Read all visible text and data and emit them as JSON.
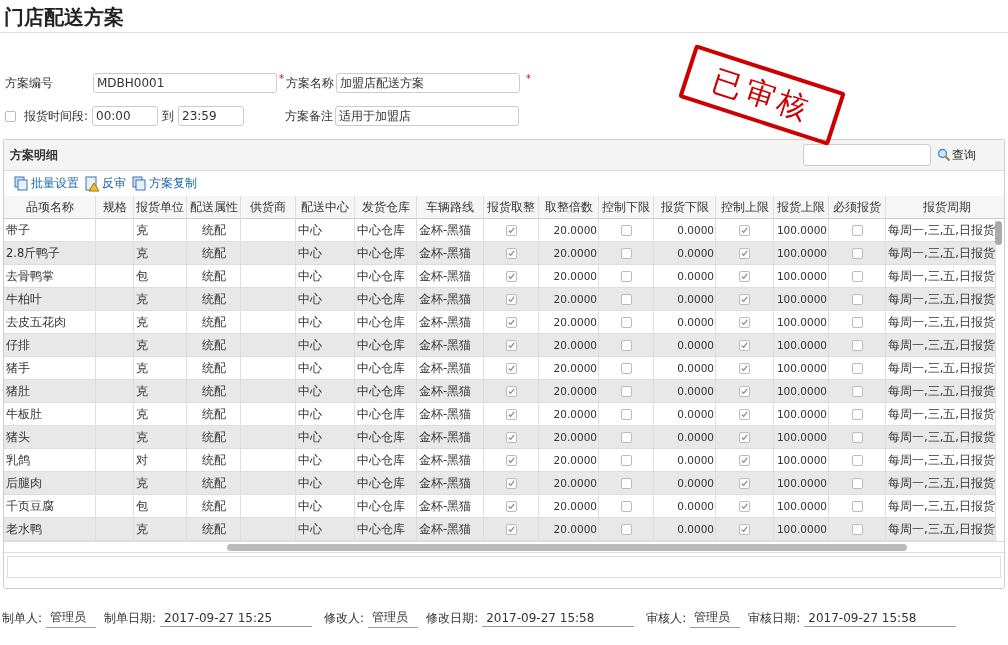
{
  "page_title": "门店配送方案",
  "stamp": "已审核",
  "form": {
    "code": {
      "label": "方案编号",
      "value": "MDBH0001"
    },
    "name": {
      "required_mark": "*",
      "label": "方案名称",
      "value": "加盟店配送方案",
      "trailing_mark": "*"
    },
    "time_range": {
      "checked": false,
      "label": "报货时间段",
      "separator": ":",
      "from": "00:00",
      "to_label": "到",
      "to": "23:59"
    },
    "note": {
      "label": "方案备注",
      "value": "适用于加盟店"
    }
  },
  "panel": {
    "title": "方案明细",
    "search": {
      "button": "查询"
    },
    "toolbar": [
      {
        "label": "批量设置"
      },
      {
        "label": "反审"
      },
      {
        "label": "方案复制"
      }
    ],
    "table": {
      "columns": [
        {
          "label": "品项名称",
          "kind": "text"
        },
        {
          "label": "规格",
          "kind": "text"
        },
        {
          "label": "报货单位",
          "kind": "text"
        },
        {
          "label": "配送属性",
          "kind": "center"
        },
        {
          "label": "供货商",
          "kind": "text"
        },
        {
          "label": "配送中心",
          "kind": "text"
        },
        {
          "label": "发货仓库",
          "kind": "text"
        },
        {
          "label": "车辆路线",
          "kind": "text"
        },
        {
          "label": "报货取整",
          "kind": "check"
        },
        {
          "label": "取整倍数",
          "kind": "number"
        },
        {
          "label": "控制下限",
          "kind": "check"
        },
        {
          "label": "报货下限",
          "kind": "number"
        },
        {
          "label": "控制上限",
          "kind": "check"
        },
        {
          "label": "报货上限",
          "kind": "number"
        },
        {
          "label": "必须报货",
          "kind": "check"
        },
        {
          "label": "报货周期",
          "kind": "text"
        }
      ],
      "rows": [
        {
          "cells": [
            "带子",
            "",
            "克",
            "统配",
            "",
            "中心",
            "中心仓库",
            "金杯-黑猫",
            true,
            "20.0000",
            false,
            "0.0000",
            true,
            "100.0000",
            false,
            "每周一,三,五,日报货"
          ]
        },
        {
          "cells": [
            "2.8斤鸭子",
            "",
            "克",
            "统配",
            "",
            "中心",
            "中心仓库",
            "金杯-黑猫",
            true,
            "20.0000",
            false,
            "0.0000",
            true,
            "100.0000",
            false,
            "每周一,三,五,日报货"
          ]
        },
        {
          "cells": [
            "去骨鸭掌",
            "",
            "包",
            "统配",
            "",
            "中心",
            "中心仓库",
            "金杯-黑猫",
            true,
            "20.0000",
            false,
            "0.0000",
            true,
            "100.0000",
            false,
            "每周一,三,五,日报货"
          ]
        },
        {
          "cells": [
            "牛柏叶",
            "",
            "克",
            "统配",
            "",
            "中心",
            "中心仓库",
            "金杯-黑猫",
            true,
            "20.0000",
            false,
            "0.0000",
            true,
            "100.0000",
            false,
            "每周一,三,五,日报货"
          ]
        },
        {
          "cells": [
            "去皮五花肉",
            "",
            "克",
            "统配",
            "",
            "中心",
            "中心仓库",
            "金杯-黑猫",
            true,
            "20.0000",
            false,
            "0.0000",
            true,
            "100.0000",
            false,
            "每周一,三,五,日报货"
          ]
        },
        {
          "cells": [
            "仔排",
            "",
            "克",
            "统配",
            "",
            "中心",
            "中心仓库",
            "金杯-黑猫",
            true,
            "20.0000",
            false,
            "0.0000",
            true,
            "100.0000",
            false,
            "每周一,三,五,日报货"
          ]
        },
        {
          "cells": [
            "猪手",
            "",
            "克",
            "统配",
            "",
            "中心",
            "中心仓库",
            "金杯-黑猫",
            true,
            "20.0000",
            false,
            "0.0000",
            true,
            "100.0000",
            false,
            "每周一,三,五,日报货"
          ]
        },
        {
          "cells": [
            "猪肚",
            "",
            "克",
            "统配",
            "",
            "中心",
            "中心仓库",
            "金杯-黑猫",
            true,
            "20.0000",
            false,
            "0.0000",
            true,
            "100.0000",
            false,
            "每周一,三,五,日报货"
          ]
        },
        {
          "cells": [
            "牛板肚",
            "",
            "克",
            "统配",
            "",
            "中心",
            "中心仓库",
            "金杯-黑猫",
            true,
            "20.0000",
            false,
            "0.0000",
            true,
            "100.0000",
            false,
            "每周一,三,五,日报货"
          ]
        },
        {
          "cells": [
            "猪头",
            "",
            "克",
            "统配",
            "",
            "中心",
            "中心仓库",
            "金杯-黑猫",
            true,
            "20.0000",
            false,
            "0.0000",
            true,
            "100.0000",
            false,
            "每周一,三,五,日报货"
          ]
        },
        {
          "cells": [
            "乳鸽",
            "",
            "对",
            "统配",
            "",
            "中心",
            "中心仓库",
            "金杯-黑猫",
            true,
            "20.0000",
            false,
            "0.0000",
            true,
            "100.0000",
            false,
            "每周一,三,五,日报货"
          ]
        },
        {
          "cells": [
            "后腿肉",
            "",
            "克",
            "统配",
            "",
            "中心",
            "中心仓库",
            "金杯-黑猫",
            true,
            "20.0000",
            false,
            "0.0000",
            true,
            "100.0000",
            false,
            "每周一,三,五,日报货"
          ]
        },
        {
          "cells": [
            "千页豆腐",
            "",
            "包",
            "统配",
            "",
            "中心",
            "中心仓库",
            "金杯-黑猫",
            true,
            "20.0000",
            false,
            "0.0000",
            true,
            "100.0000",
            false,
            "每周一,三,五,日报货"
          ]
        },
        {
          "cells": [
            "老水鸭",
            "",
            "克",
            "统配",
            "",
            "中心",
            "中心仓库",
            "金杯-黑猫",
            true,
            "20.0000",
            false,
            "0.0000",
            true,
            "100.0000",
            false,
            "每周一,三,五,日报货"
          ]
        }
      ]
    }
  },
  "footer": [
    {
      "label": "制单人:",
      "value": "管理员"
    },
    {
      "label": "制单日期:",
      "value": "2017-09-27 15:25"
    },
    {
      "label": "修改人:",
      "value": "管理员"
    },
    {
      "label": "修改日期:",
      "value": "2017-09-27 15:58"
    },
    {
      "label": "审核人:",
      "value": "管理员"
    },
    {
      "label": "审核日期:",
      "value": "2017-09-27 15:58"
    }
  ]
}
